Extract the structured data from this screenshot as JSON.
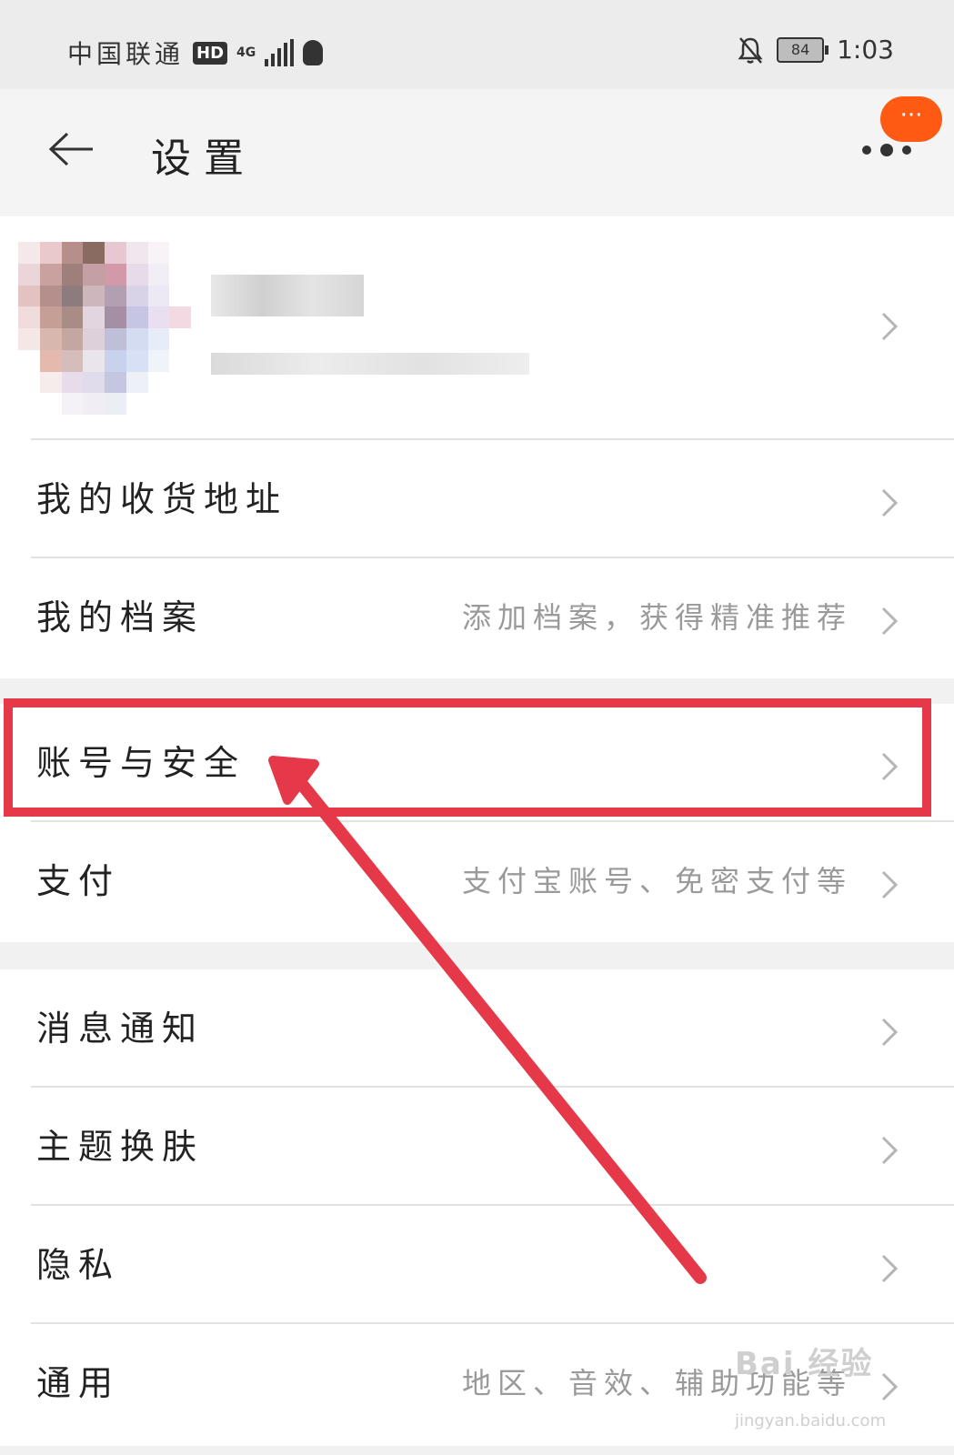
{
  "status_bar": {
    "carrier": "中国联通",
    "hd": "HD",
    "network": "4G",
    "battery": "84",
    "time": "1:03"
  },
  "header": {
    "title": "设置",
    "floating_badge": "···"
  },
  "profile": {},
  "groups": [
    {
      "rows": [
        {
          "label": "我的收货地址",
          "hint": ""
        },
        {
          "label": "我的档案",
          "hint": "添加档案，获得精准推荐"
        }
      ]
    },
    {
      "rows": [
        {
          "label": "账号与安全",
          "hint": ""
        },
        {
          "label": "支付",
          "hint": "支付宝账号、免密支付等"
        }
      ]
    },
    {
      "rows": [
        {
          "label": "消息通知",
          "hint": ""
        },
        {
          "label": "主题换肤",
          "hint": ""
        },
        {
          "label": "隐私",
          "hint": ""
        },
        {
          "label": "通用",
          "hint": "地区、音效、辅助功能等"
        }
      ]
    }
  ],
  "watermark": {
    "text": "Bai 经验",
    "url": "jingyan.baidu.com"
  },
  "colors": {
    "accent_orange": "#ff5a14",
    "annotation_red": "#e5394a"
  }
}
